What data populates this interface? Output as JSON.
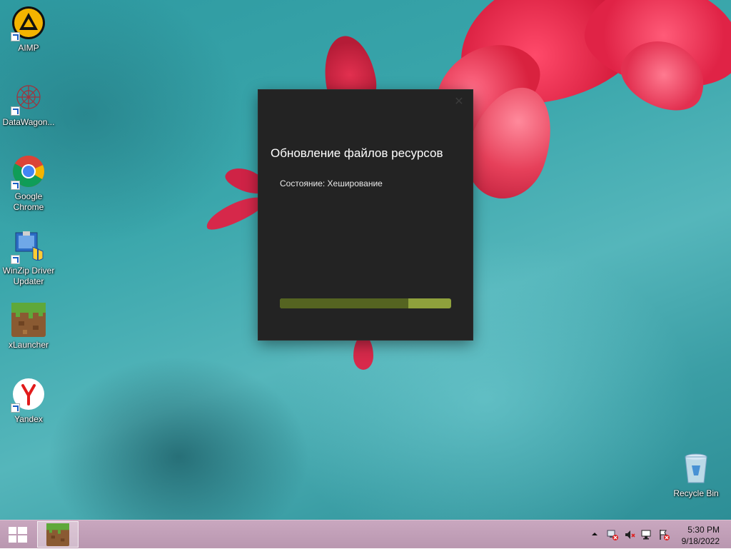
{
  "desktop": {
    "icons": [
      {
        "label": "AIMP",
        "icon": "aimp-icon"
      },
      {
        "label": "DataWagon...",
        "icon": "datawagon-icon"
      },
      {
        "label": "Google\nChrome",
        "icon": "chrome-icon"
      },
      {
        "label": "WinZip Driver\nUpdater",
        "icon": "winzip-driver-updater-icon"
      },
      {
        "label": "xLauncher",
        "icon": "xlauncher-icon"
      },
      {
        "label": "Yandex",
        "icon": "yandex-icon"
      },
      {
        "label": "Recycle Bin",
        "icon": "recycle-bin-icon"
      }
    ]
  },
  "dialog": {
    "title": "Обновление файлов ресурсов",
    "status": "Состояние: Хеширование",
    "progress_fraction": 0.75,
    "close_icon": "close-icon"
  },
  "taskbar": {
    "start_icon": "windows-start-icon",
    "pinned_app_icon": "xlauncher-icon",
    "tray_icons": [
      "show-hidden-icons-chevron",
      "network-error-icon",
      "volume-muted-icon",
      "network-icon",
      "action-center-icon"
    ],
    "clock": {
      "time": "5:30 PM",
      "date": "9/18/2022"
    }
  },
  "colors": {
    "dialog_bg": "#232323",
    "progress_fill": "#556421",
    "progress_track": "#8fa13c",
    "taskbar": "#c2a0b9"
  }
}
